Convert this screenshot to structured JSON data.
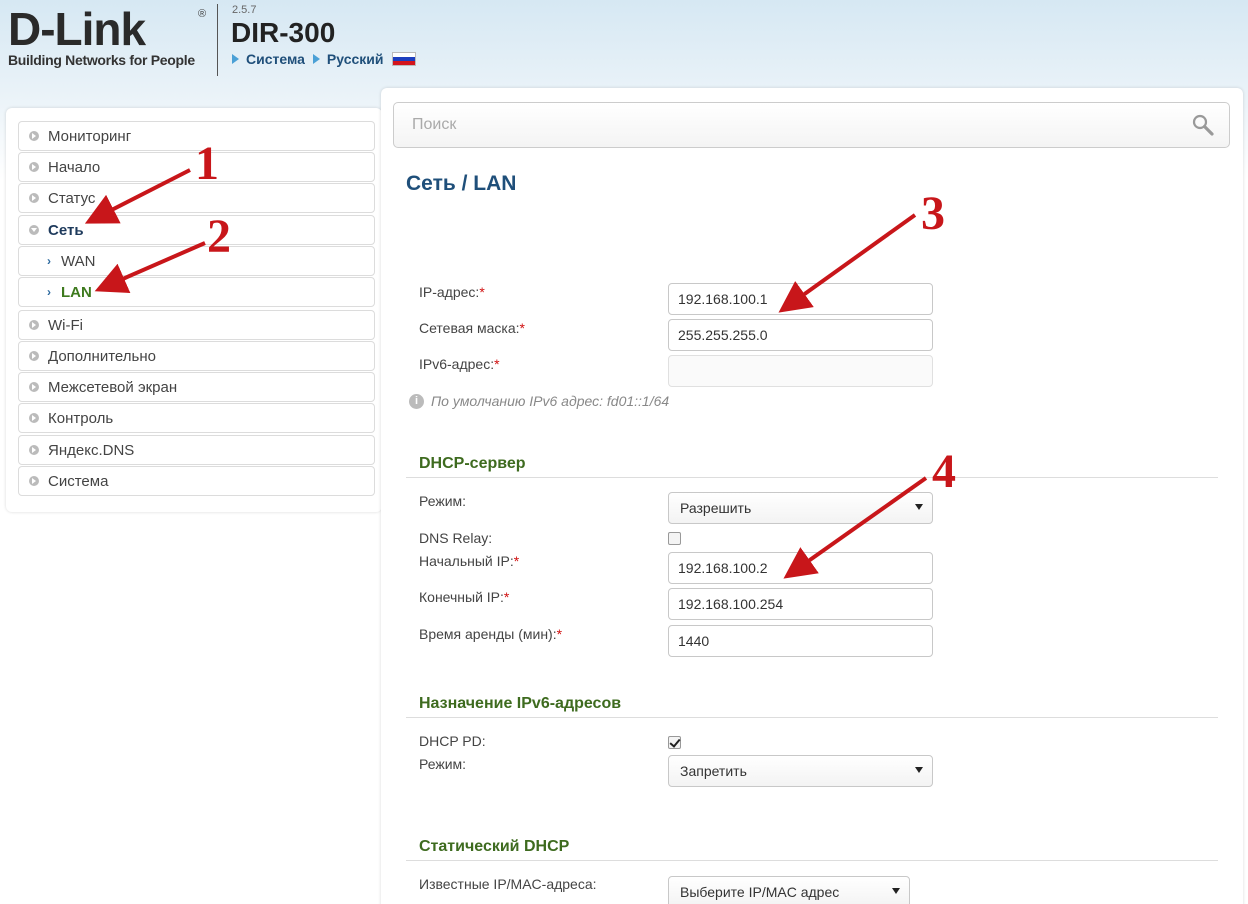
{
  "header": {
    "logo": "D-Link",
    "logo_reg": "®",
    "slogan": "Building Networks for People",
    "fw_version": "2.5.7",
    "model": "DIR-300",
    "links": [
      "Система",
      "Русский"
    ]
  },
  "sidebar": {
    "items": [
      {
        "label": "Мониторинг"
      },
      {
        "label": "Начало"
      },
      {
        "label": "Статус"
      },
      {
        "label": "Сеть"
      },
      {
        "label": "WAN"
      },
      {
        "label": "LAN"
      },
      {
        "label": "Wi-Fi"
      },
      {
        "label": "Дополнительно"
      },
      {
        "label": "Межсетевой экран"
      },
      {
        "label": "Контроль"
      },
      {
        "label": "Яндекс.DNS"
      },
      {
        "label": "Система"
      }
    ]
  },
  "search": {
    "placeholder": "Поиск"
  },
  "main": {
    "title": "Сеть /  LAN",
    "ip_label": "IP-адрес:",
    "ip_value": "192.168.100.1",
    "mask_label": "Сетевая маска:",
    "mask_value": "255.255.255.0",
    "ipv6_label": "IPv6-адрес:",
    "ipv6_value": "",
    "ipv6_hint": "По умолчанию IPv6 адрес: fd01::1/64",
    "required_mark": "*"
  },
  "dhcp": {
    "title": "DHCP-сервер",
    "mode_label": "Режим:",
    "mode_value": "Разрешить",
    "dns_relay_label": "DNS Relay:",
    "dns_relay_checked": false,
    "start_label": "Начальный IP:",
    "start_value": "192.168.100.2",
    "end_label": "Конечный IP:",
    "end_value": "192.168.100.254",
    "lease_label": "Время аренды (мин):",
    "lease_value": "1440"
  },
  "ipv6_assign": {
    "title": "Назначение IPv6-адресов",
    "dhcp_pd_label": "DHCP PD:",
    "dhcp_pd_checked": true,
    "mode_label": "Режим:",
    "mode_value": "Запретить"
  },
  "static_dhcp": {
    "title": "Статический DHCP",
    "known_label": "Известные IP/MAC-адреса:",
    "known_value": "Выберите IP/MAC адрес"
  },
  "annotations": [
    "1",
    "2",
    "3",
    "4"
  ],
  "colors": {
    "accent_blue": "#1f4f7a",
    "section_green": "#3e6b1f",
    "active_green": "#3e7a1e",
    "annotation_red": "#c8161a"
  }
}
